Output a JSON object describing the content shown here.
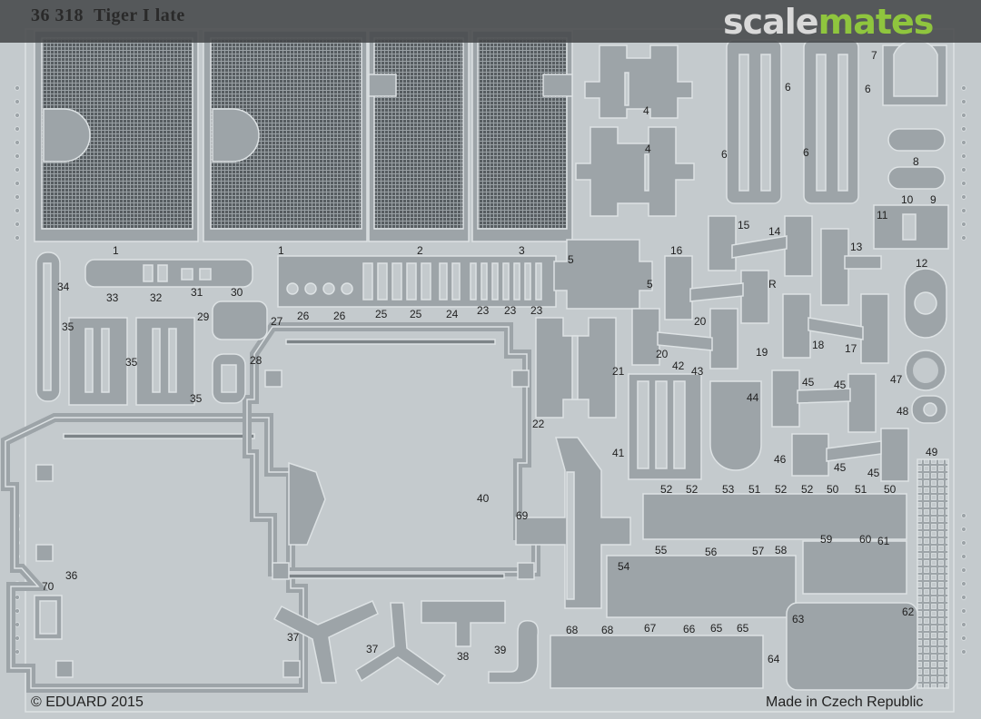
{
  "sheet": {
    "code": "36 318",
    "name": "Tiger I late",
    "copyright": "© EDUARD 2015",
    "origin": "Made in Czech Republic",
    "watermark": {
      "part1": "scale",
      "part2": "mates"
    },
    "colors": {
      "background": "#c4cacd",
      "part": "#9da4a8",
      "edge": "#dde2e4",
      "mesh": "#5a6064",
      "watermark_green": "#8fc53e"
    }
  },
  "part_numbers": {
    "p1a": "1",
    "p1b": "1",
    "p2": "2",
    "p3": "3",
    "p4a": "4",
    "p4b": "4",
    "p5a": "5",
    "p5b": "5",
    "p6a": "6",
    "p6b": "6",
    "p6c": "6",
    "p6d": "6",
    "p7": "7",
    "p8": "8",
    "p9": "9",
    "p10": "10",
    "p11": "11",
    "p12": "12",
    "p13": "13",
    "p14": "14",
    "p15": "15",
    "p16": "16",
    "p17": "17",
    "p18": "18",
    "p19": "19",
    "p20a": "20",
    "p20b": "20",
    "p21": "21",
    "p22": "22",
    "p23a": "23",
    "p23b": "23",
    "p23c": "23",
    "p24": "24",
    "p25a": "25",
    "p25b": "25",
    "p26a": "26",
    "p26b": "26",
    "p27": "27",
    "p28": "28",
    "p29": "29",
    "p30": "30",
    "p31": "31",
    "p32": "32",
    "p33": "33",
    "p34": "34",
    "p35a": "35",
    "p35b": "35",
    "p35c": "35",
    "p36": "36",
    "p37a": "37",
    "p37b": "37",
    "p38": "38",
    "p39": "39",
    "p40": "40",
    "p41": "41",
    "p42": "42",
    "p43": "43",
    "p44": "44",
    "p45a": "45",
    "p45b": "45",
    "p45c": "45",
    "p45d": "45",
    "p46": "46",
    "p47": "47",
    "p48": "48",
    "p49": "49",
    "p50a": "50",
    "p50b": "50",
    "p50c": "50",
    "p51a": "51",
    "p51b": "51",
    "p52a": "52",
    "p52b": "52",
    "p52c": "52",
    "p52d": "52",
    "p53": "53",
    "p54": "54",
    "p55": "55",
    "p56": "56",
    "p57": "57",
    "p58": "58",
    "p59": "59",
    "p60": "60",
    "p61": "61",
    "p62": "62",
    "p63": "63",
    "p64": "64",
    "p65a": "65",
    "p65b": "65",
    "p66": "66",
    "p67": "67",
    "p68a": "68",
    "p68b": "68",
    "p69": "69",
    "p70": "70",
    "pR": "R"
  }
}
